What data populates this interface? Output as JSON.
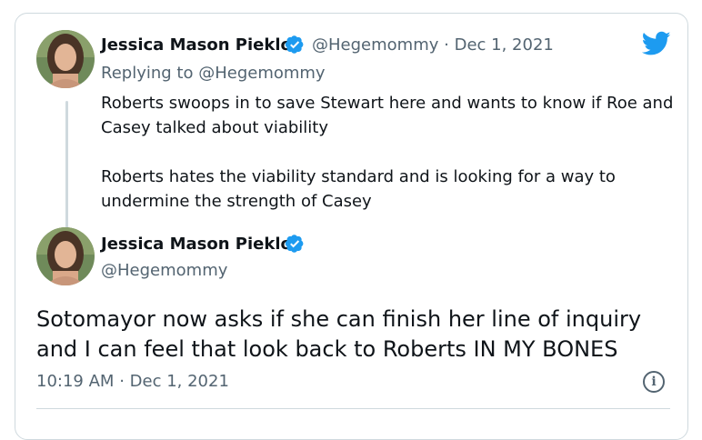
{
  "reply_tweet": {
    "author_name": "Jessica Mason Pieklo",
    "handle": "@Hegemommy",
    "separator": "·",
    "date": "Dec 1, 2021",
    "replying_prefix": "Replying to ",
    "replying_to": "@Hegemommy",
    "paragraph_1": "Roberts swoops in to save Stewart here and wants to know if Roe and Casey talked about viability",
    "paragraph_2": "Roberts hates the viability standard and is looking for a way to undermine the strength of Casey"
  },
  "main_tweet": {
    "author_name": "Jessica Mason Pieklo",
    "handle": "@Hegemommy",
    "text": "Sotomayor now asks if she can finish her line of inquiry and I can feel that look back to Roberts IN MY BONES",
    "time": "10:19 AM",
    "separator": "·",
    "date": "Dec 1, 2021"
  },
  "icons": {
    "logo": "twitter-bird-icon",
    "verified": "verified-badge-icon",
    "info": "info-icon",
    "info_glyph": "i"
  },
  "colors": {
    "accent": "#1d9bf0",
    "text": "#0f1419",
    "muted": "#536471",
    "border": "#cfd9de"
  }
}
